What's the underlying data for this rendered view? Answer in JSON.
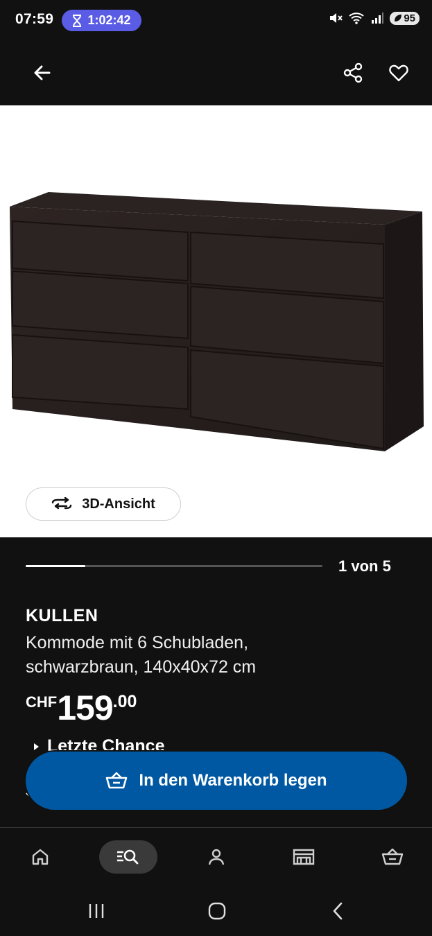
{
  "status_bar": {
    "time": "07:59",
    "timer": "1:02:42",
    "battery": "95"
  },
  "app_bar": {
    "back_icon": "arrow-left-icon",
    "share_icon": "share-icon",
    "favorite_icon": "heart-icon"
  },
  "gallery": {
    "view3d_label": "3D-Ansicht",
    "page_counter": "1 von 5",
    "progress": 0.2
  },
  "product": {
    "name": "KULLEN",
    "description_line1": "Kommode mit 6 Schubladen,",
    "description_line2": "schwarzbraun, 140x40x72 cm",
    "currency": "CHF",
    "price_integer": "159",
    "price_decimal": ".00",
    "availability": "Letzte Chance"
  },
  "cart_button": {
    "label": "In den Warenkorb legen"
  },
  "bottom_nav": [
    {
      "icon": "home-icon"
    },
    {
      "icon": "search-icon"
    },
    {
      "icon": "profile-icon"
    },
    {
      "icon": "store-icon"
    },
    {
      "icon": "basket-icon"
    }
  ],
  "colors": {
    "background": "#111111",
    "accent_blue": "#0058a3",
    "timer_pill": "#5b5ce6"
  }
}
